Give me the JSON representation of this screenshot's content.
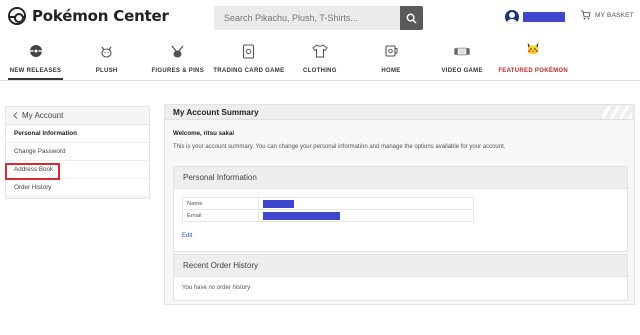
{
  "header": {
    "logo_text": "Pokémon Center",
    "search_placeholder": "Search Pikachu, Plush, T-Shirts...",
    "basket_label": "MY BASKET"
  },
  "nav": {
    "items": [
      {
        "label": "NEW RELEASES",
        "icon": "pokeball-icon"
      },
      {
        "label": "PLUSH",
        "icon": "plush-icon"
      },
      {
        "label": "FIGURES & PINS",
        "icon": "figure-icon"
      },
      {
        "label": "TRADING CARD GAME",
        "icon": "card-icon"
      },
      {
        "label": "CLOTHING",
        "icon": "shirt-icon"
      },
      {
        "label": "HOME",
        "icon": "mug-icon"
      },
      {
        "label": "VIDEO GAME",
        "icon": "console-icon"
      },
      {
        "label": "FEATURED POKÉMON",
        "icon": "pikachu-icon"
      }
    ],
    "active_index": 0
  },
  "sidebar": {
    "title": "My Account",
    "items": [
      {
        "label": "Personal Information"
      },
      {
        "label": "Change Password"
      },
      {
        "label": "Address Book"
      },
      {
        "label": "Order History"
      }
    ]
  },
  "main": {
    "title": "My Account Summary",
    "welcome": "Welcome, ritsu sakai",
    "summary": "This is your account summary. You can change your personal information and manage the options available for your account.",
    "personal": {
      "title": "Personal Information",
      "rows": [
        {
          "label": "Name"
        },
        {
          "label": "Email"
        }
      ],
      "edit_label": "Edit"
    },
    "orders": {
      "title": "Recent Order History",
      "empty_text": "You have no order history"
    }
  },
  "colors": {
    "redaction": "#3f48cc",
    "highlight": "#d62a36",
    "featured": "#c62828",
    "link": "#1f53a8"
  }
}
